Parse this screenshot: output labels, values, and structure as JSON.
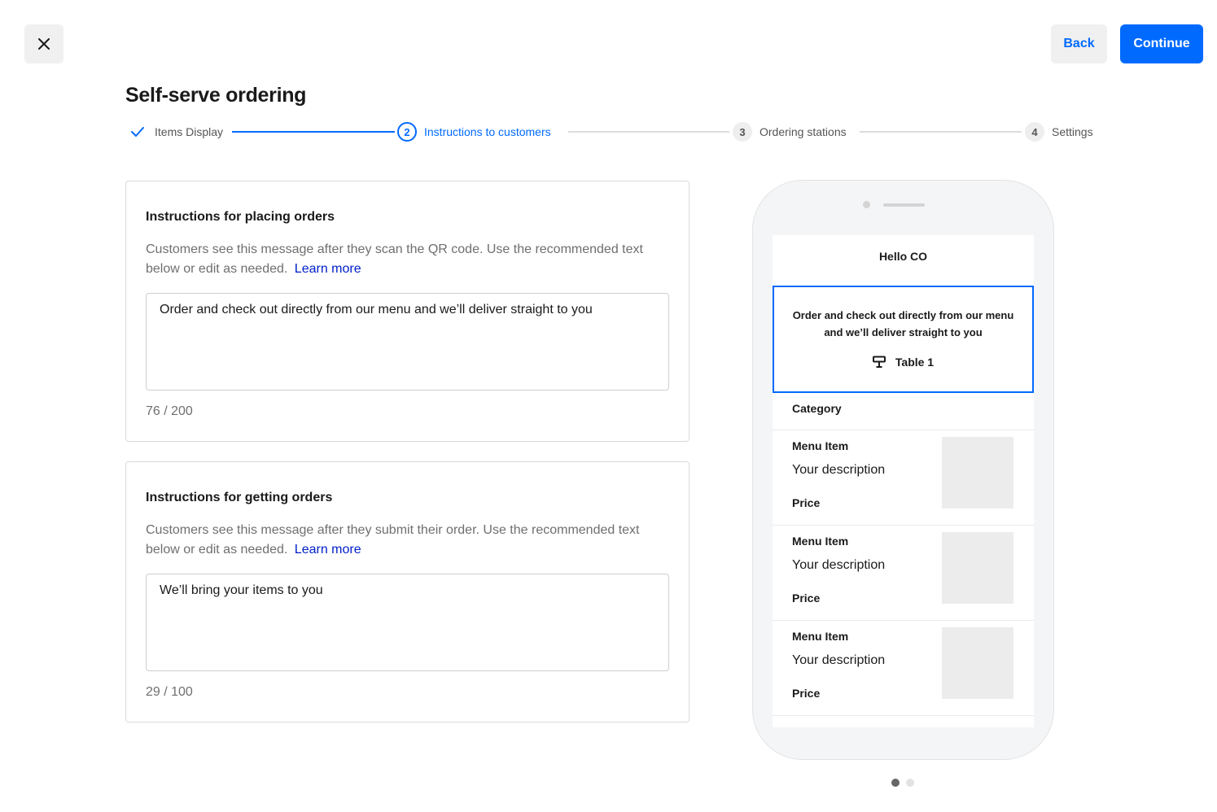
{
  "header": {
    "close_icon": "close-icon",
    "back_label": "Back",
    "continue_label": "Continue",
    "title": "Self-serve ordering",
    "accent_color": "#006aff"
  },
  "stepper": {
    "steps": [
      {
        "label": "Items Display",
        "status": "completed",
        "icon": "check-icon"
      },
      {
        "number": "2",
        "label": "Instructions to customers",
        "status": "active"
      },
      {
        "number": "3",
        "label": "Ordering stations",
        "status": "upcoming"
      },
      {
        "number": "4",
        "label": "Settings",
        "status": "upcoming"
      }
    ]
  },
  "placing_orders": {
    "title": "Instructions for placing orders",
    "description": "Customers see this message after they scan the QR code. Use the recommended text below or edit as needed.",
    "learn_more": "Learn more",
    "value": "Order and check out directly from our menu and we’ll deliver straight to you",
    "counter": "76 / 200"
  },
  "getting_orders": {
    "title": "Instructions for getting orders",
    "description": "Customers see this message after they submit their order. Use the recommended text below or edit as needed.",
    "learn_more": "Learn more",
    "value": "We’ll bring your items to you",
    "counter": "29 / 100"
  },
  "preview": {
    "store_name": "Hello CO",
    "banner_text": "Order and check out directly from our menu and we’ll deliver straight to you",
    "table_icon": "table-icon",
    "table_label": "Table 1",
    "category": "Category",
    "items": [
      {
        "name": "Menu Item",
        "description": "Your description",
        "price": "Price"
      },
      {
        "name": "Menu Item",
        "description": "Your description",
        "price": "Price"
      },
      {
        "name": "Menu Item",
        "description": "Your description",
        "price": "Price"
      }
    ],
    "pagination": {
      "pages": 2,
      "current": 1
    }
  }
}
